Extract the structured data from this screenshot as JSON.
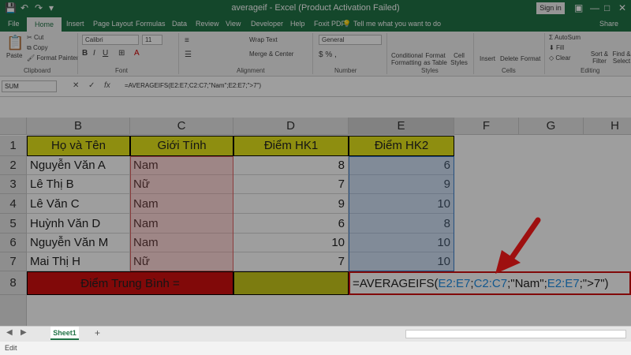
{
  "titlebar": {
    "title": "averageif  -  Excel (Product Activation Failed)",
    "sign_in": "Sign in",
    "minimize": "—",
    "restore": "□",
    "close": "✕"
  },
  "tabs": [
    "File",
    "Home",
    "Insert",
    "Page Layout",
    "Formulas",
    "Data",
    "Review",
    "View",
    "Developer",
    "Help",
    "Foxit PDF"
  ],
  "tell_me": "Tell me what you want to do",
  "share": "Share",
  "ribbon": {
    "paste": "Paste",
    "cut": "Cut",
    "copy": "Copy",
    "format_painter": "Format Painter",
    "clipboard": "Clipboard",
    "font_name": "Calibri",
    "font_size": "11",
    "font": "Font",
    "wrap_text": "Wrap Text",
    "merge_center": "Merge & Center",
    "alignment": "Alignment",
    "number_format": "General",
    "number": "Number",
    "conditional_formatting": "Conditional Formatting",
    "format_as_table": "Format as Table",
    "cell_styles": "Cell Styles",
    "styles": "Styles",
    "insert": "Insert",
    "delete": "Delete",
    "format": "Format",
    "cells": "Cells",
    "autosum": "AutoSum",
    "fill": "Fill",
    "clear": "Clear",
    "sort_filter": "Sort & Filter",
    "find_select": "Find & Select",
    "editing": "Editing"
  },
  "formula_bar": {
    "name_box": "SUM",
    "cancel": "✕",
    "enter": "✓",
    "fx": "fx",
    "formula": "=AVERAGEIFS(E2:E7;C2:C7;\"Nam\";E2:E7;\">7\")"
  },
  "columns": [
    "B",
    "C",
    "D",
    "E",
    "F",
    "G",
    "H"
  ],
  "rows": [
    "1",
    "2",
    "3",
    "4",
    "5",
    "6",
    "7",
    "8"
  ],
  "table": {
    "headers": [
      "Họ và Tên",
      "Giới Tính",
      "Điểm HK1",
      "Điểm HK2"
    ],
    "data": [
      [
        "Nguyễn Văn A",
        "Nam",
        "8",
        "6"
      ],
      [
        "Lê Thị B",
        "Nữ",
        "7",
        "9"
      ],
      [
        "Lê Văn C",
        "Nam",
        "9",
        "10"
      ],
      [
        "Huỳnh Văn D",
        "Nam",
        "6",
        "8"
      ],
      [
        "Nguyễn Văn M",
        "Nam",
        "10",
        "10"
      ],
      [
        "Mai Thị H",
        "Nữ",
        "7",
        "10"
      ]
    ],
    "summary_label": "Điểm Trung Bình =",
    "formula_parts": [
      "=AVERAGEIFS(",
      "E2:E7",
      ";",
      "C2:C7",
      ";\"Nam\";",
      "E2:E7",
      ";\">7\")"
    ]
  },
  "sheet_tab": "Sheet1",
  "add_sheet": "+",
  "status": "Edit",
  "colors": {
    "excel_green": "#217346",
    "header_yellow": "#e5e51a",
    "summary_red": "#d01010",
    "range_blue": "#1e8ee6",
    "arrow_red": "#ff1a1a"
  }
}
